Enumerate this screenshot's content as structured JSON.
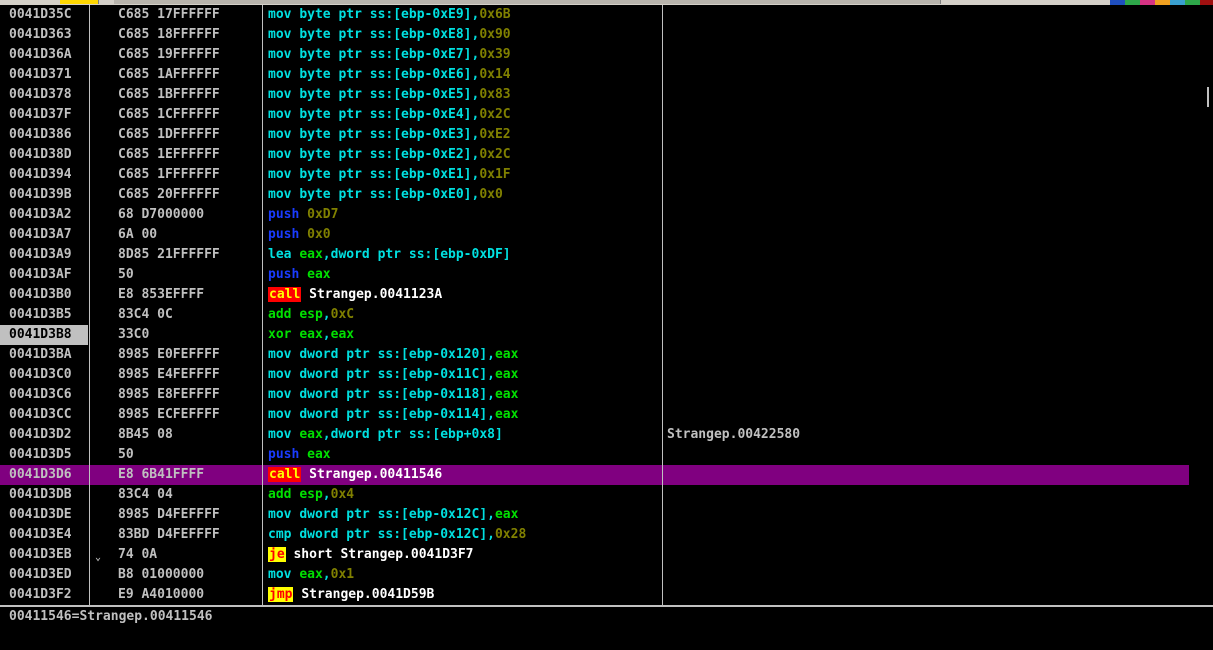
{
  "toolbar": {
    "buttons": 60
  },
  "colors": {
    "eip_row": "#800080",
    "background": "#000000"
  },
  "rows": [
    {
      "addr": "0041D35C",
      "hex": "C685 17FFFFFF",
      "mn": "mov",
      "type": "cyan",
      "op1": "byte ptr ss:[ebp-0xE9]",
      "op2": "0x6B",
      "op2type": "num"
    },
    {
      "addr": "0041D363",
      "hex": "C685 18FFFFFF",
      "mn": "mov",
      "type": "cyan",
      "op1": "byte ptr ss:[ebp-0xE8]",
      "op2": "0x90",
      "op2type": "num"
    },
    {
      "addr": "0041D36A",
      "hex": "C685 19FFFFFF",
      "mn": "mov",
      "type": "cyan",
      "op1": "byte ptr ss:[ebp-0xE7]",
      "op2": "0x39",
      "op2type": "num"
    },
    {
      "addr": "0041D371",
      "hex": "C685 1AFFFFFF",
      "mn": "mov",
      "type": "cyan",
      "op1": "byte ptr ss:[ebp-0xE6]",
      "op2": "0x14",
      "op2type": "num"
    },
    {
      "addr": "0041D378",
      "hex": "C685 1BFFFFFF",
      "mn": "mov",
      "type": "cyan",
      "op1": "byte ptr ss:[ebp-0xE5]",
      "op2": "0x83",
      "op2type": "num"
    },
    {
      "addr": "0041D37F",
      "hex": "C685 1CFFFFFF",
      "mn": "mov",
      "type": "cyan",
      "op1": "byte ptr ss:[ebp-0xE4]",
      "op2": "0x2C",
      "op2type": "num"
    },
    {
      "addr": "0041D386",
      "hex": "C685 1DFFFFFF",
      "mn": "mov",
      "type": "cyan",
      "op1": "byte ptr ss:[ebp-0xE3]",
      "op2": "0xE2",
      "op2type": "num"
    },
    {
      "addr": "0041D38D",
      "hex": "C685 1EFFFFFF",
      "mn": "mov",
      "type": "cyan",
      "op1": "byte ptr ss:[ebp-0xE2]",
      "op2": "0x2C",
      "op2type": "num"
    },
    {
      "addr": "0041D394",
      "hex": "C685 1FFFFFFF",
      "mn": "mov",
      "type": "cyan",
      "op1": "byte ptr ss:[ebp-0xE1]",
      "op2": "0x1F",
      "op2type": "num"
    },
    {
      "addr": "0041D39B",
      "hex": "C685 20FFFFFF",
      "mn": "mov",
      "type": "cyan",
      "op1": "byte ptr ss:[ebp-0xE0]",
      "op2": "0x0",
      "op2type": "num"
    },
    {
      "addr": "0041D3A2",
      "hex": "68 D7000000",
      "mn": "push",
      "type": "blue",
      "op1": "0xD7",
      "op1type": "num"
    },
    {
      "addr": "0041D3A7",
      "hex": "6A 00",
      "mn": "push",
      "type": "blue",
      "op1": "0x0",
      "op1type": "num"
    },
    {
      "addr": "0041D3A9",
      "hex": "8D85 21FFFFFF",
      "mn": "lea",
      "type": "cyan",
      "op1": "eax",
      "op1type": "reg",
      "op2": "dword ptr ss:[ebp-0xDF]",
      "op2type": "mem"
    },
    {
      "addr": "0041D3AF",
      "hex": "50",
      "mn": "push",
      "type": "blue",
      "op1": "eax",
      "op1type": "reg"
    },
    {
      "addr": "0041D3B0",
      "hex": "E8 853EFFFF",
      "mn": "call",
      "type": "call",
      "op1": "Strangep.0041123A",
      "op1type": "lbl"
    },
    {
      "addr": "0041D3B5",
      "hex": "83C4 0C",
      "mn": "add",
      "type": "green",
      "op1": "esp",
      "op1type": "reg",
      "op2": "0xC",
      "op2type": "num"
    },
    {
      "addr": "0041D3B8",
      "hex": "33C0",
      "mn": "xor",
      "type": "green",
      "op1": "eax",
      "op1type": "reg",
      "op2": "eax",
      "op2type": "reg",
      "selected": true
    },
    {
      "addr": "0041D3BA",
      "hex": "8985 E0FEFFFF",
      "mn": "mov",
      "type": "cyan",
      "op1": "dword ptr ss:[ebp-0x120]",
      "op2": "eax",
      "op2type": "reg"
    },
    {
      "addr": "0041D3C0",
      "hex": "8985 E4FEFFFF",
      "mn": "mov",
      "type": "cyan",
      "op1": "dword ptr ss:[ebp-0x11C]",
      "op2": "eax",
      "op2type": "reg"
    },
    {
      "addr": "0041D3C6",
      "hex": "8985 E8FEFFFF",
      "mn": "mov",
      "type": "cyan",
      "op1": "dword ptr ss:[ebp-0x118]",
      "op2": "eax",
      "op2type": "reg"
    },
    {
      "addr": "0041D3CC",
      "hex": "8985 ECFEFFFF",
      "mn": "mov",
      "type": "cyan",
      "op1": "dword ptr ss:[ebp-0x114]",
      "op2": "eax",
      "op2type": "reg"
    },
    {
      "addr": "0041D3D2",
      "hex": "8B45 08",
      "mn": "mov",
      "type": "cyan",
      "op1": "eax",
      "op1type": "reg",
      "op2": "dword ptr ss:[ebp+0x8]",
      "op2type": "mem",
      "comment": "Strangep.00422580"
    },
    {
      "addr": "0041D3D5",
      "hex": "50",
      "mn": "push",
      "type": "blue",
      "op1": "eax",
      "op1type": "reg"
    },
    {
      "addr": "0041D3D6",
      "hex": "E8 6B41FFFF",
      "mn": "call",
      "type": "call",
      "op1": "Strangep.00411546",
      "op1type": "lbl",
      "eip": true
    },
    {
      "addr": "0041D3DB",
      "hex": "83C4 04",
      "mn": "add",
      "type": "green",
      "op1": "esp",
      "op1type": "reg",
      "op2": "0x4",
      "op2type": "num"
    },
    {
      "addr": "0041D3DE",
      "hex": "8985 D4FEFFFF",
      "mn": "mov",
      "type": "cyan",
      "op1": "dword ptr ss:[ebp-0x12C]",
      "op2": "eax",
      "op2type": "reg"
    },
    {
      "addr": "0041D3E4",
      "hex": "83BD D4FEFFFF",
      "mn": "cmp",
      "type": "cyan",
      "op1": "dword ptr ss:[ebp-0x12C]",
      "op2": "0x28",
      "op2type": "num"
    },
    {
      "addr": "0041D3EB",
      "hex": "74 0A",
      "mn": "je",
      "type": "jmp",
      "op1": "short Strangep.0041D3F7",
      "op1type": "lbl",
      "arrow": "⌄"
    },
    {
      "addr": "0041D3ED",
      "hex": "B8 01000000",
      "mn": "mov",
      "type": "cyan",
      "op1": "eax",
      "op1type": "reg",
      "op2": "0x1",
      "op2type": "num"
    },
    {
      "addr": "0041D3F2",
      "hex": "E9 A4010000",
      "mn": "jmp",
      "type": "jmp",
      "op1": "Strangep.0041D59B",
      "op1type": "lbl"
    }
  ],
  "info_text": "00411546=Strangep.00411546"
}
